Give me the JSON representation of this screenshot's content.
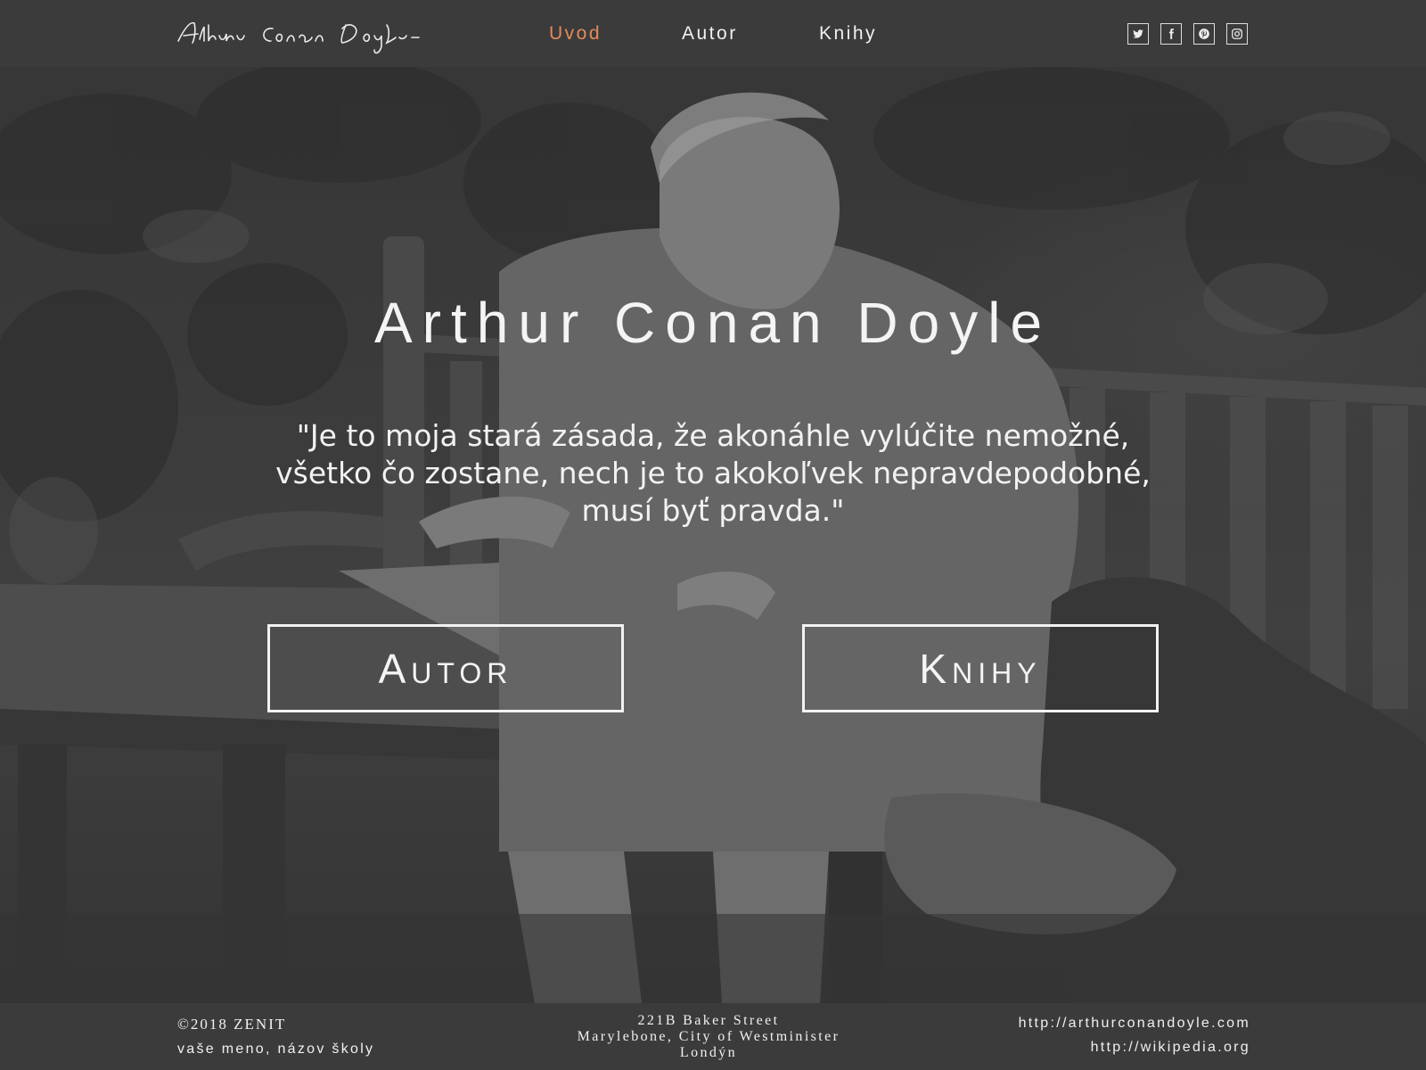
{
  "header": {
    "logo_text": "Arthur Conan Doyle",
    "nav": [
      {
        "label": "Uvod",
        "active": true
      },
      {
        "label": "Autor",
        "active": false
      },
      {
        "label": "Knihy",
        "active": false
      }
    ],
    "social": [
      "twitter-icon",
      "facebook-icon",
      "pinterest-icon",
      "instagram-icon"
    ],
    "accent_color": "#e78a5a"
  },
  "hero": {
    "title": "Arthur Conan Doyle",
    "quote_lines": [
      "\"Je to moja stará zásada, že akonáhle vylúčite nemožné,",
      "všetko čo zostane, nech je to akokoľvek nepravdepodobné,",
      "musí  byť pravda.\""
    ],
    "buttons": {
      "autor": "Autor",
      "knihy": "Knihy"
    }
  },
  "footer": {
    "copyright": "©2018 ZENIT",
    "school": "vaše meno, názov školy",
    "address_lines": [
      "221B Baker Street",
      "Marylebone, City of Westminister",
      "Londýn"
    ],
    "links": [
      "http://arthurconandoyle.com",
      "http://wikipedia.org"
    ]
  }
}
